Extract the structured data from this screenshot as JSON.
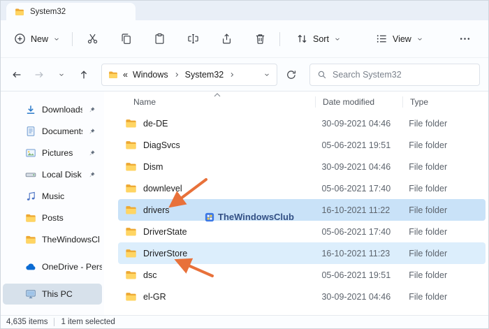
{
  "window": {
    "tab_title": "System32"
  },
  "toolbar": {
    "new_button": {
      "label": "New",
      "icon": "plus-circle-icon"
    },
    "icon_buttons": [
      {
        "name": "cut-button",
        "icon": "cut-icon"
      },
      {
        "name": "copy-button",
        "icon": "copy-icon"
      },
      {
        "name": "paste-button",
        "icon": "paste-icon"
      },
      {
        "name": "rename-button",
        "icon": "rename-icon"
      },
      {
        "name": "share-button",
        "icon": "share-icon"
      },
      {
        "name": "delete-button",
        "icon": "delete-icon"
      }
    ],
    "sort_button": {
      "label": "Sort",
      "icon": "sort-icon"
    },
    "view_button": {
      "label": "View",
      "icon": "view-icon"
    },
    "more_button": {
      "icon": "more-icon"
    }
  },
  "address_bar": {
    "collapsed_marker": "«",
    "segments": [
      "Windows",
      "System32"
    ],
    "search_placeholder": "Search System32"
  },
  "sidebar": {
    "items": [
      {
        "label": "Downloads",
        "icon": "downloads-icon",
        "pinned": true
      },
      {
        "label": "Documents",
        "icon": "documents-icon",
        "pinned": true
      },
      {
        "label": "Pictures",
        "icon": "pictures-icon",
        "pinned": true
      },
      {
        "label": "Local Disk (F:)",
        "icon": "drive-icon",
        "pinned": true
      },
      {
        "label": "Music",
        "icon": "music-icon"
      },
      {
        "label": "Posts",
        "icon": "folder-icon"
      },
      {
        "label": "TheWindowsCl",
        "icon": "folder-icon"
      },
      {
        "label": "OneDrive - Perso",
        "icon": "cloud-icon",
        "gap_before": true
      },
      {
        "label": "This PC",
        "icon": "pc-icon",
        "selected": true,
        "gap_before": true
      }
    ]
  },
  "file_list": {
    "columns": {
      "name": "Name",
      "date": "Date modified",
      "type": "Type"
    },
    "rows": [
      {
        "name": "de-DE",
        "date": "30-09-2021 04:46",
        "type": "File folder",
        "icon": "folder-icon"
      },
      {
        "name": "DiagSvcs",
        "date": "05-06-2021 19:51",
        "type": "File folder",
        "icon": "folder-icon"
      },
      {
        "name": "Dism",
        "date": "30-09-2021 04:46",
        "type": "File folder",
        "icon": "folder-icon"
      },
      {
        "name": "downlevel",
        "date": "05-06-2021 17:40",
        "type": "File folder",
        "icon": "folder-icon"
      },
      {
        "name": "drivers",
        "date": "16-10-2021 11:22",
        "type": "File folder",
        "icon": "folder-icon",
        "highlight": "strong"
      },
      {
        "name": "DriverState",
        "date": "05-06-2021 17:40",
        "type": "File folder",
        "icon": "folder-icon"
      },
      {
        "name": "DriverStore",
        "date": "16-10-2021 11:23",
        "type": "File folder",
        "icon": "folder-icon",
        "highlight": "light"
      },
      {
        "name": "dsc",
        "date": "05-06-2021 19:51",
        "type": "File folder",
        "icon": "folder-icon"
      },
      {
        "name": "el-GR",
        "date": "30-09-2021 04:46",
        "type": "File folder",
        "icon": "folder-icon"
      }
    ]
  },
  "watermark": {
    "text": "TheWindowsClub"
  },
  "status_bar": {
    "items_count": "4,635 items",
    "selection": "1 item selected"
  },
  "colors": {
    "selection_strong": "#c9e2f8",
    "selection_light": "#dceefc",
    "sidebar_selected": "#d7e1eb",
    "arrow": "#e8713a",
    "accent": "#0b6bd3"
  }
}
